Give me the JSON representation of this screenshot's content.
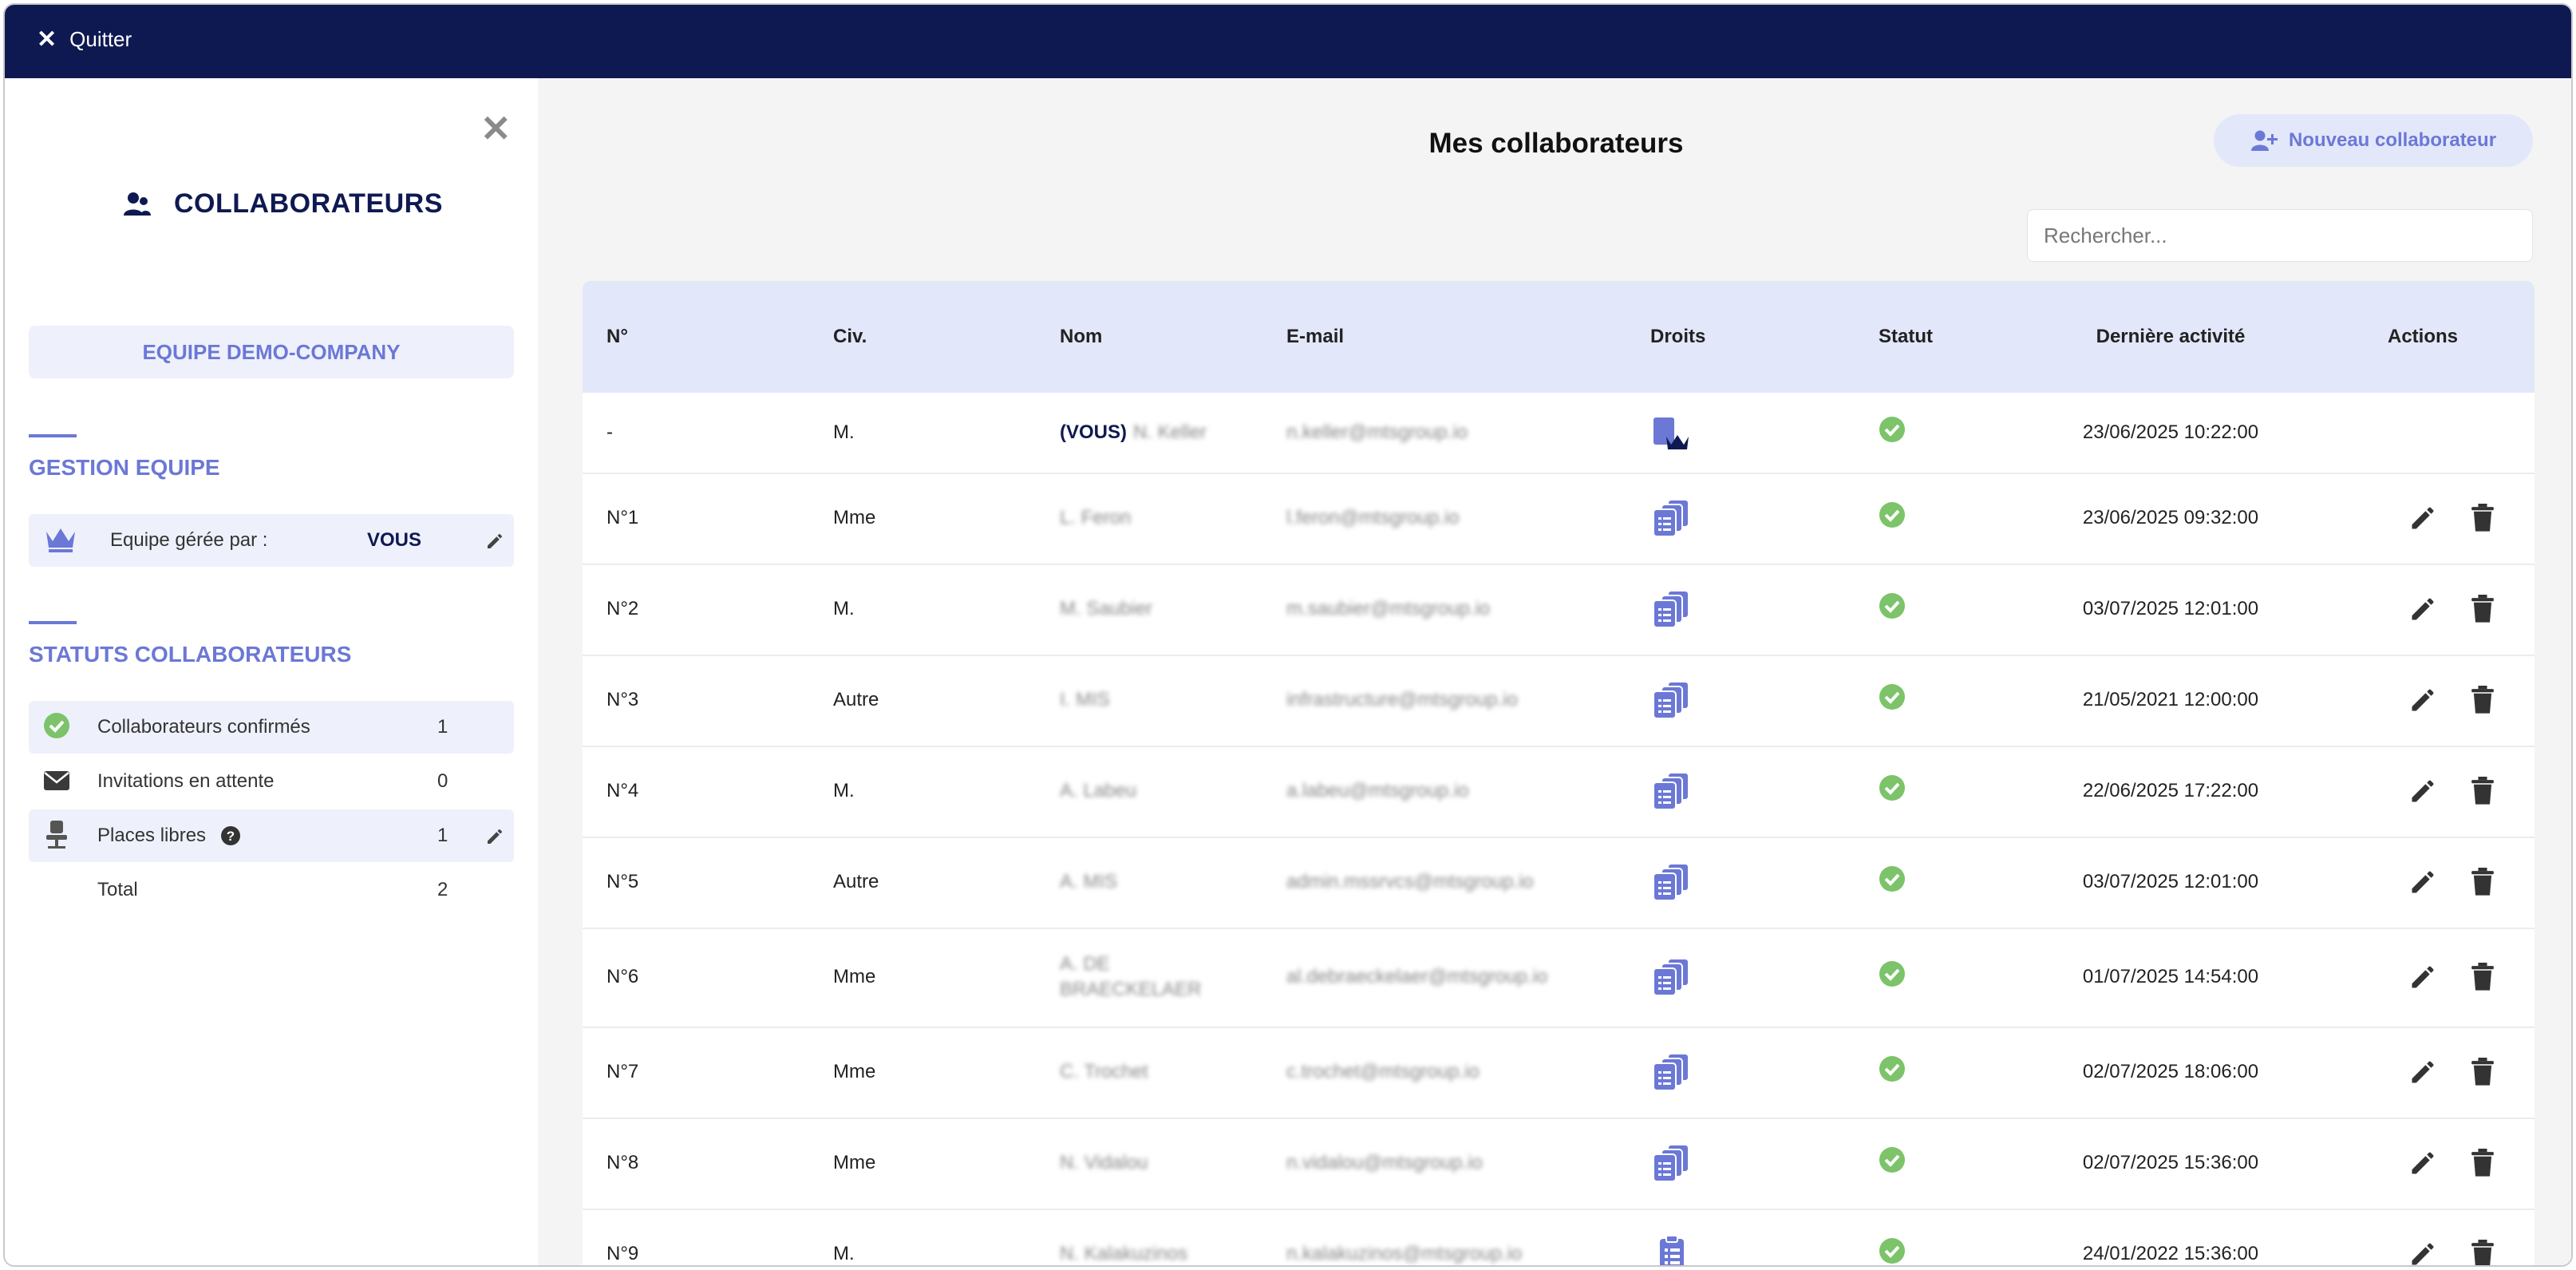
{
  "topbar": {
    "quit_label": "Quitter"
  },
  "sidebar": {
    "title": "COLLABORATEURS",
    "team_label": "EQUIPE DEMO-COMPANY",
    "gestion": {
      "heading": "GESTION EQUIPE",
      "managed_by_label": "Equipe gérée par :",
      "managed_by_value": "VOUS"
    },
    "statuts": {
      "heading": "STATUTS COLLABORATEURS",
      "items": [
        {
          "label": "Collaborateurs confirmés",
          "count": "1",
          "icon": "check-circle-icon"
        },
        {
          "label": "Invitations en attente",
          "count": "0",
          "icon": "envelope-icon"
        },
        {
          "label": "Places libres",
          "count": "1",
          "icon": "chair-icon"
        },
        {
          "label": "Total",
          "count": "2",
          "icon": ""
        }
      ]
    }
  },
  "main": {
    "title": "Mes collaborateurs",
    "new_button_label": "Nouveau collaborateur",
    "search_placeholder": "Rechercher...",
    "columns": [
      "N°",
      "Civ.",
      "Nom",
      "E-mail",
      "Droits",
      "Statut",
      "Dernière activité",
      "Actions"
    ],
    "rows": [
      {
        "num": "-",
        "civ": "M.",
        "you_tag": "(VOUS)",
        "name": "N. Keller",
        "email": "n.keller@mtsgroup.io",
        "rights": "admin",
        "last": "23/06/2025 10:22:00"
      },
      {
        "num": "N°1",
        "civ": "Mme",
        "you_tag": "",
        "name": "L. Feron",
        "email": "l.feron@mtsgroup.io",
        "rights": "multi",
        "last": "23/06/2025 09:32:00"
      },
      {
        "num": "N°2",
        "civ": "M.",
        "you_tag": "",
        "name": "M. Saubier",
        "email": "m.saubier@mtsgroup.io",
        "rights": "multi",
        "last": "03/07/2025 12:01:00"
      },
      {
        "num": "N°3",
        "civ": "Autre",
        "you_tag": "",
        "name": "I. MIS",
        "email": "infrastructure@mtsgroup.io",
        "rights": "multi",
        "last": "21/05/2021 12:00:00"
      },
      {
        "num": "N°4",
        "civ": "M.",
        "you_tag": "",
        "name": "A. Labeu",
        "email": "a.labeu@mtsgroup.io",
        "rights": "multi",
        "last": "22/06/2025 17:22:00"
      },
      {
        "num": "N°5",
        "civ": "Autre",
        "you_tag": "",
        "name": "A. MIS",
        "email": "admin.mssrvcs@mtsgroup.io",
        "rights": "multi",
        "last": "03/07/2025 12:01:00"
      },
      {
        "num": "N°6",
        "civ": "Mme",
        "you_tag": "",
        "name": "A. DE BRAECKELAER",
        "email": "al.debraeckelaer@mtsgroup.io",
        "rights": "multi",
        "last": "01/07/2025 14:54:00"
      },
      {
        "num": "N°7",
        "civ": "Mme",
        "you_tag": "",
        "name": "C. Trochet",
        "email": "c.trochet@mtsgroup.io",
        "rights": "multi",
        "last": "02/07/2025 18:06:00"
      },
      {
        "num": "N°8",
        "civ": "Mme",
        "you_tag": "",
        "name": "N. Vidalou",
        "email": "n.vidalou@mtsgroup.io",
        "rights": "multi",
        "last": "02/07/2025 15:36:00"
      },
      {
        "num": "N°9",
        "civ": "M.",
        "you_tag": "",
        "name": "N. Kalakuzinos",
        "email": "n.kalakuzinos@mtsgroup.io",
        "rights": "single",
        "last": "24/01/2022 15:36:00"
      }
    ]
  },
  "colors": {
    "navy": "#0f1951",
    "accent": "#6b78d6",
    "success": "#7cc36a",
    "header_bg": "#e3e7fa"
  }
}
